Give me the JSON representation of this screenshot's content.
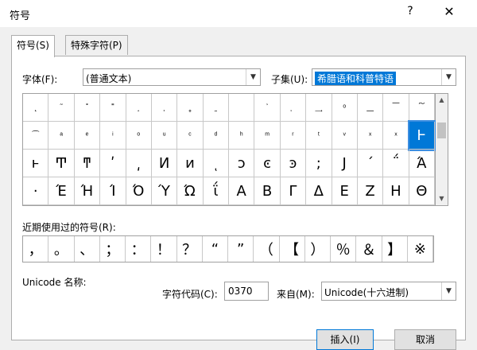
{
  "window": {
    "title": "符号",
    "help_icon": "?",
    "close_icon": "✕"
  },
  "tabs": [
    {
      "label": "符号(S)"
    },
    {
      "label": "特殊字符(P)"
    }
  ],
  "font": {
    "label": "字体(F):",
    "value": "(普通文本)"
  },
  "subset": {
    "label": "子集(U):",
    "value": "希腊语和科普特语"
  },
  "symbol_rows": [
    [
      "˛",
      "˜",
      "˟",
      "˭",
      "˰",
      "˲",
      "˳",
      "˷",
      "͏",
      "͐",
      "ͅ",
      "͢",
      "ͦ",
      "͟",
      "͞",
      "͠"
    ],
    [
      "͡",
      "ͣ",
      "ͤ",
      "ͥ",
      "ͦ",
      "ͧ",
      "ͨ",
      "ͩ",
      "ͪ",
      "ͫ",
      "ͬ",
      "ͭ",
      "ͮ",
      "ͯ",
      "ͯ",
      "Ͱ"
    ],
    [
      "ͱ",
      "Ͳ",
      "ͳ",
      "ʹ",
      "͵",
      "Ͷ",
      "ͷ",
      "ͺ",
      "ͻ",
      "ͼ",
      "ͽ",
      ";",
      "Ϳ",
      "΄",
      "΅",
      "Ά"
    ],
    [
      "·",
      "Έ",
      "Ή",
      "Ί",
      "Ό",
      "Ύ",
      "Ώ",
      "ΐ",
      "Α",
      "Β",
      "Γ",
      "Δ",
      "Ε",
      "Ζ",
      "Η",
      "Θ"
    ]
  ],
  "recent": {
    "label": "近期使用过的符号(R):",
    "items": [
      "，",
      "。",
      "、",
      "；",
      "：",
      "！",
      "？",
      "“",
      "”",
      "（",
      "【",
      "）",
      "％",
      "＆",
      "】",
      "※"
    ]
  },
  "unicode_name": {
    "label": "Unicode 名称:"
  },
  "char_code": {
    "label": "字符代码(C):",
    "value": "0370"
  },
  "from": {
    "label": "来自(M):",
    "value": "Unicode(十六进制)"
  },
  "buttons": {
    "insert": "插入(I)",
    "cancel": "取消"
  }
}
